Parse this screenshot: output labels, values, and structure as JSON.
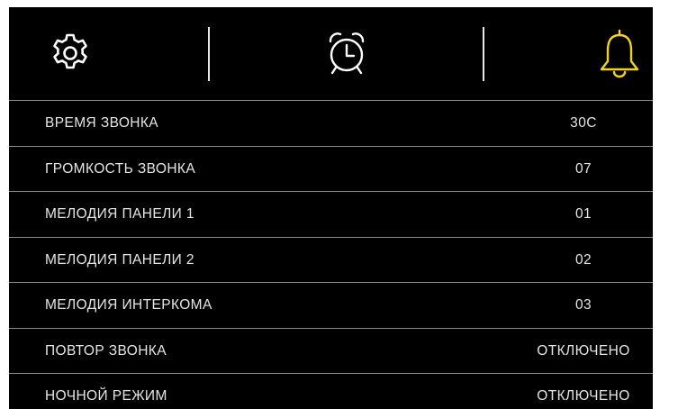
{
  "toolbar": {
    "tabs": [
      {
        "icon": "gear-icon",
        "active": false
      },
      {
        "icon": "alarm-clock-icon",
        "active": false
      },
      {
        "icon": "bell-icon",
        "active": true
      }
    ],
    "colors": {
      "active_icon": "#f2d21b",
      "inactive_icon": "#ffffff"
    }
  },
  "settings": {
    "rows": [
      {
        "label": "ВРЕМЯ ЗВОНКА",
        "value": "30С"
      },
      {
        "label": "ГРОМКОСТЬ ЗВОНКА",
        "value": "07"
      },
      {
        "label": "МЕЛОДИЯ ПАНЕЛИ 1",
        "value": "01"
      },
      {
        "label": "МЕЛОДИЯ ПАНЕЛИ 2",
        "value": "02"
      },
      {
        "label": "МЕЛОДИЯ ИНТЕРКОМА",
        "value": "03"
      },
      {
        "label": "ПОВТОР ЗВОНКА",
        "value": "ОТКЛЮЧЕНО"
      },
      {
        "label": "НОЧНОЙ РЕЖИМ",
        "value": "ОТКЛЮЧЕНО"
      }
    ]
  }
}
